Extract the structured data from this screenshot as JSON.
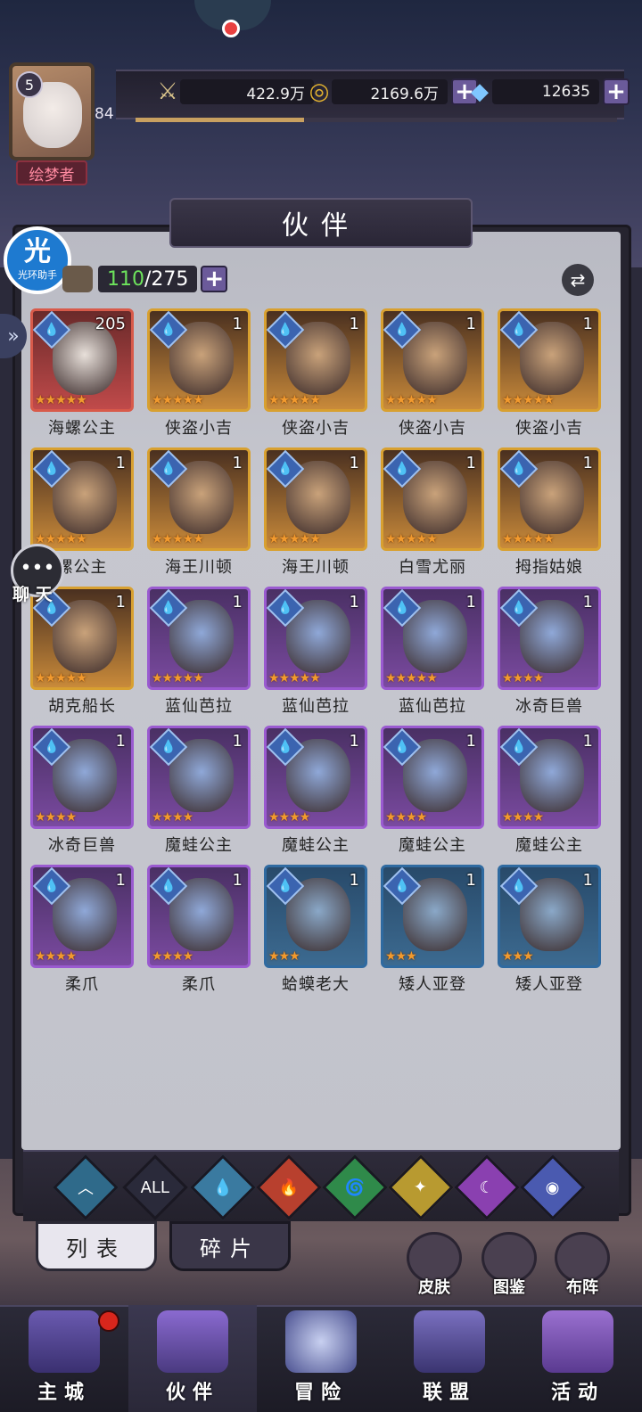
{
  "top": {
    "level": "5",
    "exp_level": "84",
    "title_badge": "绘梦者",
    "power": "422.9万",
    "gold": "2169.6万",
    "gems": "12635",
    "xp_progress": 0.35
  },
  "helper": {
    "big": "光",
    "small": "光环助手"
  },
  "chat": {
    "label": "聊 天"
  },
  "panel": {
    "title": "伙伴"
  },
  "count": {
    "current": "110",
    "total": "/275"
  },
  "heroes": [
    {
      "name": "海螺公主",
      "level": "205",
      "stars": "★★★★★",
      "frame": "red"
    },
    {
      "name": "侠盗小吉",
      "level": "1",
      "stars": "★★★★★",
      "frame": "gold"
    },
    {
      "name": "侠盗小吉",
      "level": "1",
      "stars": "★★★★★",
      "frame": "gold"
    },
    {
      "name": "侠盗小吉",
      "level": "1",
      "stars": "★★★★★",
      "frame": "gold"
    },
    {
      "name": "侠盗小吉",
      "level": "1",
      "stars": "★★★★★",
      "frame": "gold"
    },
    {
      "name": "螺公主",
      "level": "1",
      "stars": "★★★★★",
      "frame": "gold"
    },
    {
      "name": "海王川顿",
      "level": "1",
      "stars": "★★★★★",
      "frame": "gold"
    },
    {
      "name": "海王川顿",
      "level": "1",
      "stars": "★★★★★",
      "frame": "gold"
    },
    {
      "name": "白雪尤丽",
      "level": "1",
      "stars": "★★★★★",
      "frame": "gold"
    },
    {
      "name": "拇指姑娘",
      "level": "1",
      "stars": "★★★★★",
      "frame": "gold"
    },
    {
      "name": "胡克船长",
      "level": "1",
      "stars": "★★★★★",
      "frame": "gold"
    },
    {
      "name": "蓝仙芭拉",
      "level": "1",
      "stars": "★★★★★",
      "frame": "purple"
    },
    {
      "name": "蓝仙芭拉",
      "level": "1",
      "stars": "★★★★★",
      "frame": "purple"
    },
    {
      "name": "蓝仙芭拉",
      "level": "1",
      "stars": "★★★★★",
      "frame": "purple"
    },
    {
      "name": "冰奇巨兽",
      "level": "1",
      "stars": "★★★★",
      "frame": "purple"
    },
    {
      "name": "冰奇巨兽",
      "level": "1",
      "stars": "★★★★",
      "frame": "purple"
    },
    {
      "name": "魔蛙公主",
      "level": "1",
      "stars": "★★★★",
      "frame": "purple"
    },
    {
      "name": "魔蛙公主",
      "level": "1",
      "stars": "★★★★",
      "frame": "purple"
    },
    {
      "name": "魔蛙公主",
      "level": "1",
      "stars": "★★★★",
      "frame": "purple"
    },
    {
      "name": "魔蛙公主",
      "level": "1",
      "stars": "★★★★",
      "frame": "purple"
    },
    {
      "name": "柔爪",
      "level": "1",
      "stars": "★★★★",
      "frame": "purple"
    },
    {
      "name": "柔爪",
      "level": "1",
      "stars": "★★★★",
      "frame": "purple"
    },
    {
      "name": "蛤蟆老大",
      "level": "1",
      "stars": "★★★",
      "frame": "blue"
    },
    {
      "name": "矮人亚登",
      "level": "1",
      "stars": "★★★",
      "frame": "blue"
    },
    {
      "name": "矮人亚登",
      "level": "1",
      "stars": "★★★",
      "frame": "blue"
    }
  ],
  "filters": [
    {
      "name": "filter-up",
      "label": "︿",
      "color": "#2f6a8a"
    },
    {
      "name": "filter-all",
      "label": "ALL",
      "color": "#2a2a3a"
    },
    {
      "name": "filter-water",
      "label": "💧",
      "color": "#3a7aa0"
    },
    {
      "name": "filter-fire",
      "label": "🔥",
      "color": "#b8402e"
    },
    {
      "name": "filter-wind",
      "label": "🌀",
      "color": "#2f8a4a"
    },
    {
      "name": "filter-light",
      "label": "✦",
      "color": "#b89a30"
    },
    {
      "name": "filter-dark",
      "label": "☾",
      "color": "#8a40b0"
    },
    {
      "name": "filter-space",
      "label": "◉",
      "color": "#4a5ab0"
    }
  ],
  "tabs": {
    "list": "列表",
    "fragments": "碎片"
  },
  "actions": {
    "skin": "皮肤",
    "codex": "图鉴",
    "formation": "布阵"
  },
  "nav": [
    {
      "label": "主城"
    },
    {
      "label": "伙伴"
    },
    {
      "label": "冒险"
    },
    {
      "label": "联盟"
    },
    {
      "label": "活动"
    }
  ]
}
